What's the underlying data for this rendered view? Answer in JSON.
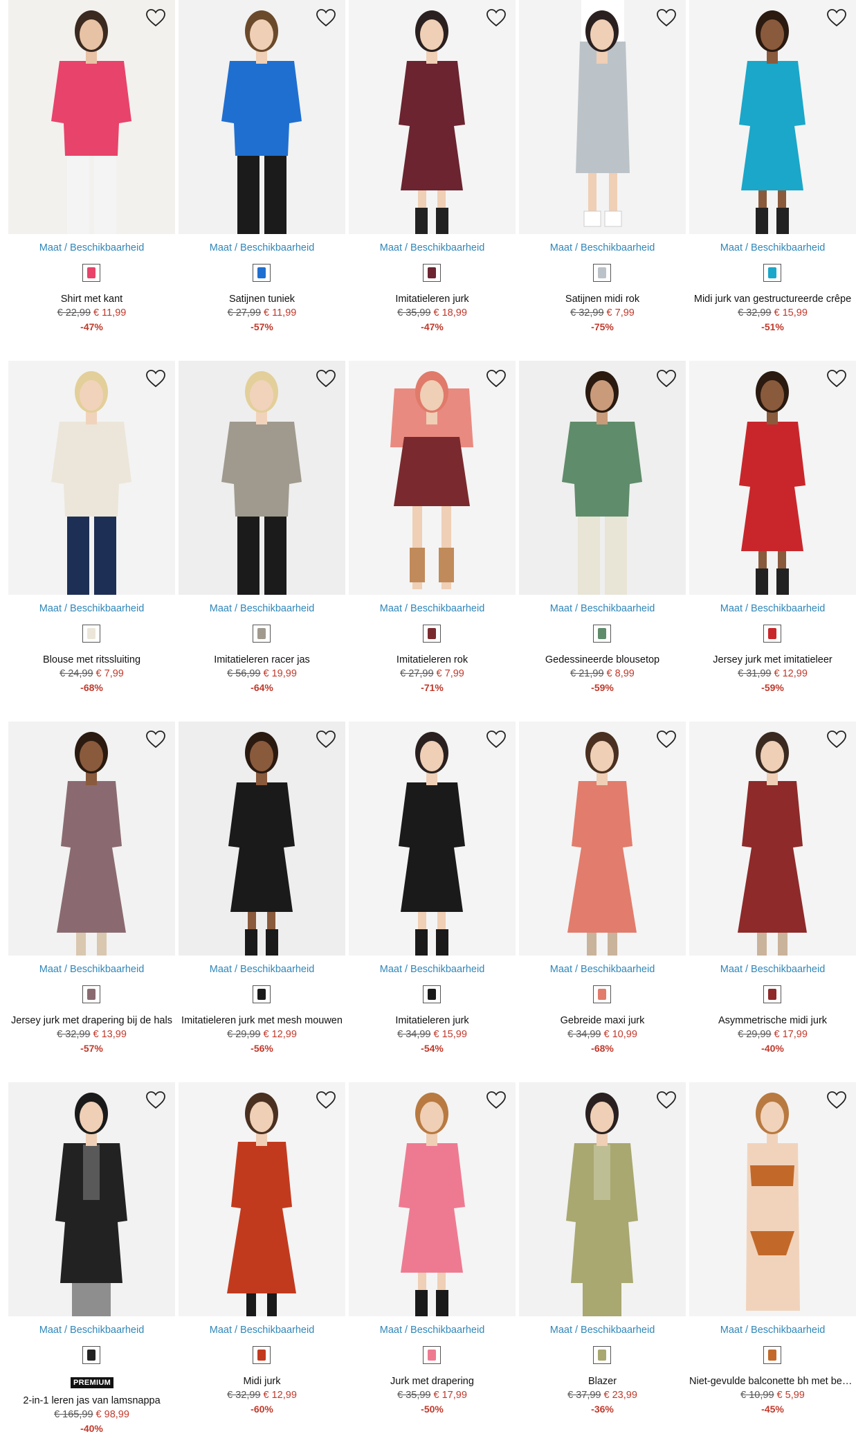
{
  "size_link_label": "Maat / Beschikbaarheid",
  "colors": {
    "link": "#2f86b8",
    "sale_price": "#c0392b",
    "old_price": "#555555"
  },
  "products": [
    {
      "name": "Shirt met kant",
      "old_price": "€ 22,99",
      "new_price": "€ 11,99",
      "discount": "-47%",
      "color": "#e8436a",
      "skin": "#e8c2a4",
      "hair": "#3a2a20",
      "bottom": "#f4f4f4",
      "bg": "#f3f1ee",
      "style": "top"
    },
    {
      "name": "Satijnen tuniek",
      "old_price": "€ 27,99",
      "new_price": "€ 11,99",
      "discount": "-57%",
      "color": "#1f6fd0",
      "skin": "#efcfb5",
      "hair": "#6b4a2b",
      "bottom": "#1b1b1b",
      "bg": "#f2f2f2",
      "style": "top"
    },
    {
      "name": "Imitatieleren jurk",
      "old_price": "€ 35,99",
      "new_price": "€ 18,99",
      "discount": "-47%",
      "color": "#6b2430",
      "skin": "#efcfb5",
      "hair": "#2a2020",
      "bottom": "#222222",
      "bg": "#f4f4f4",
      "style": "dress"
    },
    {
      "name": "Satijnen midi rok",
      "old_price": "€ 32,99",
      "new_price": "€ 7,99",
      "discount": "-75%",
      "color": "#bcc3c8",
      "skin": "#efcfb5",
      "hair": "#2a2020",
      "bottom": "#ffffff",
      "bg": "#f3f3f3",
      "style": "skirt"
    },
    {
      "name": "Midi jurk van gestructureerde crêpe",
      "old_price": "€ 32,99",
      "new_price": "€ 15,99",
      "discount": "-51%",
      "color": "#1aa7c9",
      "skin": "#8a5a3c",
      "hair": "#2a1a10",
      "bottom": "#222222",
      "bg": "#f4f4f4",
      "style": "dress"
    },
    {
      "name": "Blouse met ritssluiting",
      "old_price": "€ 24,99",
      "new_price": "€ 7,99",
      "discount": "-68%",
      "color": "#ece6da",
      "skin": "#f1d3bc",
      "hair": "#e3cf9a",
      "bottom": "#1e2f55",
      "bg": "#f3f3f3",
      "style": "top"
    },
    {
      "name": "Imitatieleren racer jas",
      "old_price": "€ 56,99",
      "new_price": "€ 19,99",
      "discount": "-64%",
      "color": "#a09a8e",
      "skin": "#f1d3bc",
      "hair": "#e3cf9a",
      "bottom": "#1b1b1b",
      "bg": "#eeeeee",
      "style": "top"
    },
    {
      "name": "Imitatieleren rok",
      "old_price": "€ 27,99",
      "new_price": "€ 7,99",
      "discount": "-71%",
      "color": "#7a2a2e",
      "skin": "#efcfb5",
      "hair": "#e07a6a",
      "bottom": "#c08a5a",
      "bg": "#f4f4f4",
      "style": "mini"
    },
    {
      "name": "Gedessineerde blousetop",
      "old_price": "€ 21,99",
      "new_price": "€ 8,99",
      "discount": "-59%",
      "color": "#5f8c6a",
      "skin": "#c99b7a",
      "hair": "#2a1a10",
      "bottom": "#e8e4d6",
      "bg": "#efefef",
      "style": "top"
    },
    {
      "name": "Jersey jurk met imitatieleer",
      "old_price": "€ 31,99",
      "new_price": "€ 12,99",
      "discount": "-59%",
      "color": "#c9262b",
      "skin": "#8a5a3c",
      "hair": "#2a1a10",
      "bottom": "#222222",
      "bg": "#f4f4f4",
      "style": "dress"
    },
    {
      "name": "Jersey jurk met drapering bij de hals",
      "old_price": "€ 32,99",
      "new_price": "€ 13,99",
      "discount": "-57%",
      "color": "#8a6a70",
      "skin": "#8a5a3c",
      "hair": "#2a1a10",
      "bottom": "#d9c7b0",
      "bg": "#f2f2f2",
      "style": "maxi"
    },
    {
      "name": "Imitatieleren jurk met mesh mouwen",
      "old_price": "€ 29,99",
      "new_price": "€ 12,99",
      "discount": "-56%",
      "color": "#1a1a1a",
      "skin": "#8a5a3c",
      "hair": "#2a1a10",
      "bottom": "#1a1a1a",
      "bg": "#eeeeee",
      "style": "dress"
    },
    {
      "name": "Imitatieleren jurk",
      "old_price": "€ 34,99",
      "new_price": "€ 15,99",
      "discount": "-54%",
      "color": "#1a1a1a",
      "skin": "#efcfb5",
      "hair": "#2a2020",
      "bottom": "#1a1a1a",
      "bg": "#f4f4f4",
      "style": "dress"
    },
    {
      "name": "Gebreide maxi jurk",
      "old_price": "€ 34,99",
      "new_price": "€ 10,99",
      "discount": "-68%",
      "color": "#e27c6c",
      "skin": "#efcfb5",
      "hair": "#4a3020",
      "bottom": "#c9b39a",
      "bg": "#f4f4f4",
      "style": "maxi"
    },
    {
      "name": "Asymmetrische midi jurk",
      "old_price": "€ 29,99",
      "new_price": "€ 17,99",
      "discount": "-40%",
      "color": "#8e2a2a",
      "skin": "#efcfb5",
      "hair": "#3a2a20",
      "bottom": "#c9b39a",
      "bg": "#f4f4f4",
      "style": "maxi"
    },
    {
      "name": "2-in-1 leren jas van lamsnappa",
      "old_price": "€ 165,99",
      "new_price": "€ 98,99",
      "discount": "-40%",
      "badge": "PREMIUM",
      "color": "#222222",
      "skin": "#efcfb5",
      "hair": "#1a1a1a",
      "bottom": "#8e8e8e",
      "bg": "#f2f2f2",
      "style": "coat"
    },
    {
      "name": "Midi jurk",
      "old_price": "€ 32,99",
      "new_price": "€ 12,99",
      "discount": "-60%",
      "color": "#c23a1e",
      "skin": "#efcfb5",
      "hair": "#4a3020",
      "bottom": "#1a1a1a",
      "bg": "#f4f4f4",
      "style": "maxi"
    },
    {
      "name": "Jurk met drapering",
      "old_price": "€ 35,99",
      "new_price": "€ 17,99",
      "discount": "-50%",
      "color": "#ee7a92",
      "skin": "#efcfb5",
      "hair": "#b87a40",
      "bottom": "#1a1a1a",
      "bg": "#f4f4f4",
      "style": "dress"
    },
    {
      "name": "Blazer",
      "old_price": "€ 37,99",
      "new_price": "€ 23,99",
      "discount": "-36%",
      "color": "#a8a870",
      "skin": "#efcfb5",
      "hair": "#2a2020",
      "bottom": "#a8a870",
      "bg": "#f2f2f2",
      "style": "coat"
    },
    {
      "name": "Niet-gevulde balconette bh met bedrukt",
      "old_price": "€ 10,99",
      "new_price": "€ 5,99",
      "discount": "-45%",
      "color": "#c2692a",
      "skin": "#f1d3bc",
      "hair": "#b87a40",
      "bottom": "#f1d3bc",
      "bg": "#f4f4f4",
      "style": "lingerie"
    }
  ]
}
